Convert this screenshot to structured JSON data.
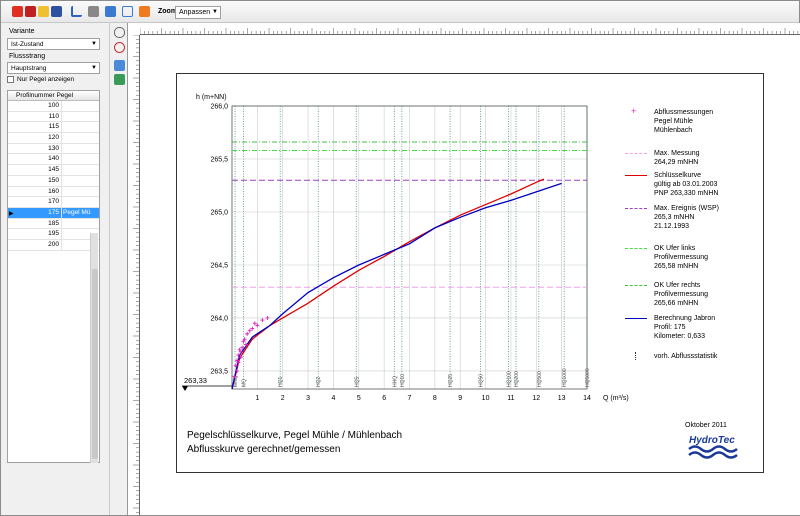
{
  "toolbar": {
    "zoom_label": "Zoom",
    "zoom_value": "Anpassen"
  },
  "sidebar": {
    "variante_label": "Variante",
    "variante_value": "Ist-Zustand",
    "flussstrang_label": "Flussstrang",
    "flussstrang_value": "Hauptstrang",
    "checkbox_label": "Nur Pegel anzeigen",
    "table_header": "Profilnummer Pegel",
    "rows": [
      {
        "num": "100",
        "pegel": ""
      },
      {
        "num": "110",
        "pegel": ""
      },
      {
        "num": "115",
        "pegel": ""
      },
      {
        "num": "120",
        "pegel": ""
      },
      {
        "num": "130",
        "pegel": ""
      },
      {
        "num": "140",
        "pegel": ""
      },
      {
        "num": "145",
        "pegel": ""
      },
      {
        "num": "150",
        "pegel": ""
      },
      {
        "num": "160",
        "pegel": ""
      },
      {
        "num": "170",
        "pegel": ""
      },
      {
        "num": "175",
        "pegel": "Pegel Mü"
      },
      {
        "num": "185",
        "pegel": ""
      },
      {
        "num": "195",
        "pegel": ""
      },
      {
        "num": "200",
        "pegel": ""
      }
    ],
    "selected_row": 10
  },
  "report": {
    "title_line1": "Pegelschlüsselkurve, Pegel Mühle / Mühlenbach",
    "title_line2": "Abflusskurve gerechnet/gemessen",
    "date": "Oktober 2011",
    "logo_text": "HydroTec",
    "start_marker": "263,33"
  },
  "legend": [
    {
      "text": "Abflussmessungen\nPegel Mühle\nMühlenbach",
      "color": "#e020c0",
      "style": "marker"
    },
    {
      "text": "Max. Messung\n264,29 mNHN",
      "color": "#f0a0f0",
      "style": "dashed"
    },
    {
      "text": "Schlüsselkurve\ngültig ab 03.01.2003\nPNP 263,330 mNHN",
      "color": "#e00000",
      "style": "solid"
    },
    {
      "text": "Max. Ereignis (WSP)\n265,3 mNHN\n21.12.1993",
      "color": "#a040c0",
      "style": "dashed"
    },
    {
      "text": "OK Ufer links\nProfilvermessung\n265,58 mNHN",
      "color": "#40e040",
      "style": "dotdash"
    },
    {
      "text": "OK Ufer rechts\nProfilvermessung\n265,66 mNHN",
      "color": "#40c040",
      "style": "dashdot"
    },
    {
      "text": "Berechnung Jabron\nProfil: 175\nKilometer: 0,633",
      "color": "#0000c0",
      "style": "solid"
    },
    {
      "text": "vorh. Abflussstatistik",
      "color": "#333333",
      "style": "dotted"
    }
  ],
  "chart_data": {
    "type": "line",
    "ylabel": "h (m+NN)",
    "xlabel": "Q (m³/s)",
    "xlim": [
      0,
      14
    ],
    "ylim": [
      263.33,
      266.0
    ],
    "x_ticks": [
      "1",
      "2",
      "3",
      "4",
      "5",
      "6",
      "7",
      "8",
      "9",
      "10",
      "11",
      "12",
      "13",
      "14"
    ],
    "y_ticks": [
      "263,5",
      "264,0",
      "264,5",
      "265,0",
      "265,5",
      "266,0"
    ],
    "hlines": [
      {
        "name": "Max. Messung",
        "y": 264.29,
        "color": "#f0a0f0"
      },
      {
        "name": "Max. Ereignis (WSP)",
        "y": 265.3,
        "color": "#a040c0"
      },
      {
        "name": "OK Ufer links",
        "y": 265.58,
        "color": "#40e040"
      },
      {
        "name": "OK Ufer rechts",
        "y": 265.66,
        "color": "#40c040"
      }
    ],
    "stat_lines": [
      {
        "label": "MNQ",
        "x": 0.12
      },
      {
        "label": "MQ",
        "x": 0.45
      },
      {
        "label": "HQ1",
        "x": 1.9
      },
      {
        "label": "HQ2",
        "x": 3.4
      },
      {
        "label": "HQ5",
        "x": 4.9
      },
      {
        "label": "HHQ",
        "x": 6.4
      },
      {
        "label": "HQ10",
        "x": 6.7
      },
      {
        "label": "HQ25",
        "x": 8.6
      },
      {
        "label": "HQ50",
        "x": 9.8
      },
      {
        "label": "HQ100",
        "x": 10.9
      },
      {
        "label": "HQ200",
        "x": 11.2
      },
      {
        "label": "HQ500",
        "x": 12.1
      },
      {
        "label": "HQ1000",
        "x": 13.1
      },
      {
        "label": "HQ5000",
        "x": 14.0
      }
    ],
    "series": [
      {
        "name": "Schlüsselkurve",
        "color": "#e00000",
        "points": [
          [
            0,
            263.33
          ],
          [
            0.3,
            263.62
          ],
          [
            0.8,
            263.8
          ],
          [
            1.5,
            263.93
          ],
          [
            2,
            264.0
          ],
          [
            3,
            264.14
          ],
          [
            4,
            264.3
          ],
          [
            5,
            264.45
          ],
          [
            6,
            264.58
          ],
          [
            7,
            264.72
          ],
          [
            8,
            264.85
          ],
          [
            9,
            264.97
          ],
          [
            10,
            265.07
          ],
          [
            11,
            265.17
          ],
          [
            12,
            265.28
          ],
          [
            12.3,
            265.31
          ]
        ]
      },
      {
        "name": "Berechnung Jabron",
        "color": "#0000c0",
        "points": [
          [
            0,
            263.33
          ],
          [
            0.3,
            263.65
          ],
          [
            0.8,
            263.82
          ],
          [
            1.5,
            263.93
          ],
          [
            2,
            264.04
          ],
          [
            3,
            264.24
          ],
          [
            4,
            264.38
          ],
          [
            5,
            264.5
          ],
          [
            6,
            264.6
          ],
          [
            7,
            264.7
          ],
          [
            8,
            264.85
          ],
          [
            9,
            264.95
          ],
          [
            10,
            265.04
          ],
          [
            11,
            265.11
          ],
          [
            12,
            265.19
          ],
          [
            13,
            265.27
          ]
        ]
      }
    ],
    "measurements": [
      [
        0.1,
        263.45
      ],
      [
        0.15,
        263.55
      ],
      [
        0.2,
        263.6
      ],
      [
        0.25,
        263.65
      ],
      [
        0.3,
        263.7
      ],
      [
        0.35,
        263.63
      ],
      [
        0.4,
        263.72
      ],
      [
        0.45,
        263.78
      ],
      [
        0.5,
        263.8
      ],
      [
        0.55,
        263.75
      ],
      [
        0.6,
        263.85
      ],
      [
        0.7,
        263.88
      ],
      [
        0.8,
        263.9
      ],
      [
        0.9,
        263.95
      ],
      [
        1.0,
        263.93
      ],
      [
        1.2,
        263.98
      ],
      [
        1.4,
        264.0
      ],
      [
        0.2,
        263.5
      ],
      [
        0.25,
        263.58
      ],
      [
        0.35,
        263.68
      ]
    ]
  }
}
